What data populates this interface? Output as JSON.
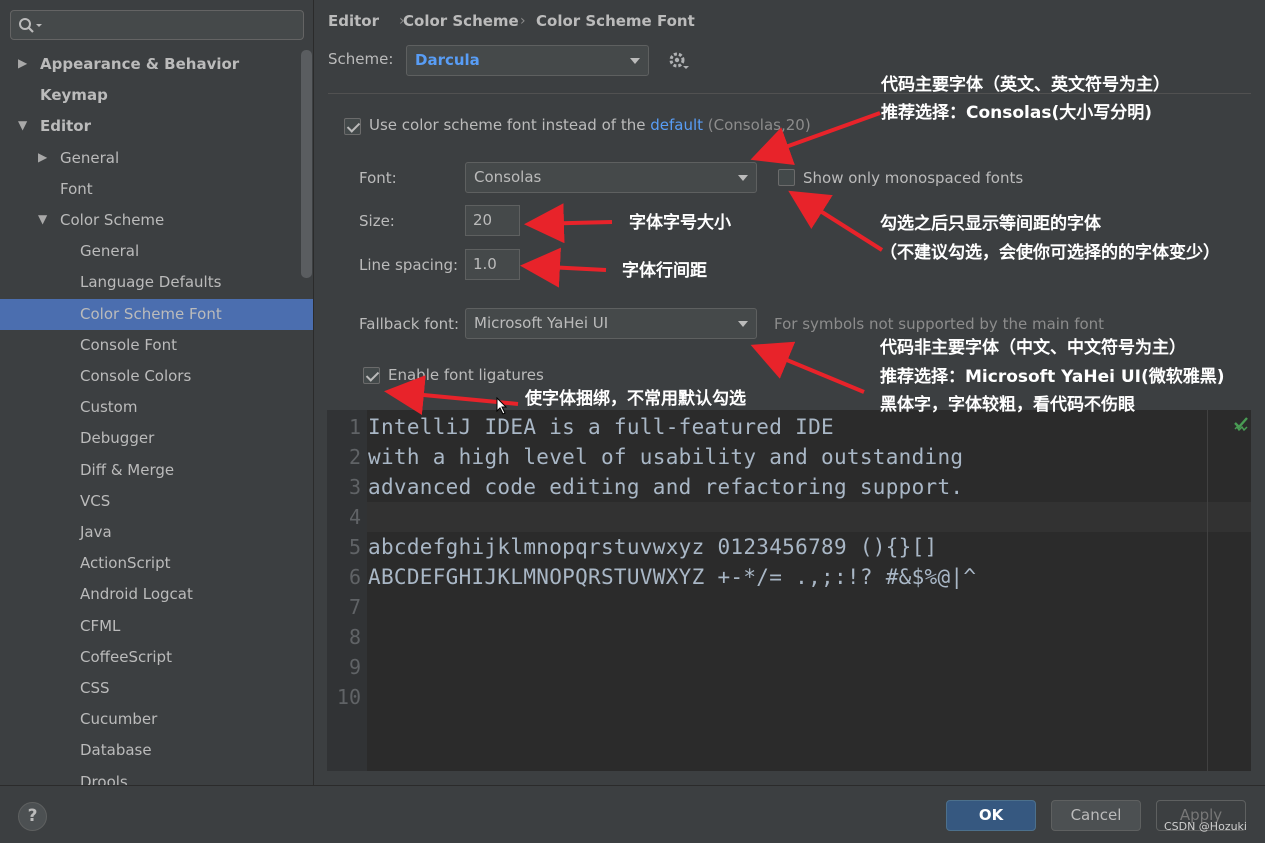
{
  "sidebar": {
    "search_placeholder": "",
    "items": [
      {
        "label": "Appearance & Behavior",
        "level": 0,
        "expanded": false,
        "bold": true
      },
      {
        "label": "Keymap",
        "level": 0,
        "bold": true
      },
      {
        "label": "Editor",
        "level": 0,
        "expanded": true,
        "bold": true
      },
      {
        "label": "General",
        "level": 1,
        "expanded": false
      },
      {
        "label": "Font",
        "level": 1
      },
      {
        "label": "Color Scheme",
        "level": 1,
        "expanded": true
      },
      {
        "label": "General",
        "level": 2
      },
      {
        "label": "Language Defaults",
        "level": 2
      },
      {
        "label": "Color Scheme Font",
        "level": 2,
        "selected": true
      },
      {
        "label": "Console Font",
        "level": 2
      },
      {
        "label": "Console Colors",
        "level": 2
      },
      {
        "label": "Custom",
        "level": 2
      },
      {
        "label": "Debugger",
        "level": 2
      },
      {
        "label": "Diff & Merge",
        "level": 2
      },
      {
        "label": "VCS",
        "level": 2
      },
      {
        "label": "Java",
        "level": 2
      },
      {
        "label": "ActionScript",
        "level": 2
      },
      {
        "label": "Android Logcat",
        "level": 2
      },
      {
        "label": "CFML",
        "level": 2
      },
      {
        "label": "CoffeeScript",
        "level": 2
      },
      {
        "label": "CSS",
        "level": 2
      },
      {
        "label": "Cucumber",
        "level": 2
      },
      {
        "label": "Database",
        "level": 2
      },
      {
        "label": "Drools",
        "level": 2
      }
    ]
  },
  "breadcrumb": [
    "Editor",
    "Color Scheme",
    "Color Scheme Font"
  ],
  "scheme": {
    "label": "Scheme:",
    "value": "Darcula"
  },
  "use_scheme_font": {
    "prefix": "Use color scheme font instead of the",
    "link": "default",
    "suffix": "(Consolas,20)",
    "checked": true
  },
  "font": {
    "label": "Font:",
    "value": "Consolas"
  },
  "monospaced": {
    "label": "Show only monospaced fonts",
    "checked": false
  },
  "size": {
    "label": "Size:",
    "value": "20"
  },
  "line_spacing": {
    "label": "Line spacing:",
    "value": "1.0"
  },
  "fallback": {
    "label": "Fallback font:",
    "value": "Microsoft YaHei UI",
    "hint": "For symbols not supported by the main font"
  },
  "ligatures": {
    "label": "Enable font ligatures",
    "checked": true
  },
  "preview": {
    "line_numbers": [
      "1",
      "2",
      "3",
      "4",
      "5",
      "6",
      "7",
      "8",
      "9",
      "10"
    ],
    "lines": [
      "IntelliJ IDEA is a full-featured IDE",
      "with a high level of usability and outstanding",
      "advanced code editing and refactoring support.",
      "",
      "abcdefghijklmnopqrstuvwxyz 0123456789 (){}[]",
      "ABCDEFGHIJKLMNOPQRSTUVWXYZ +-*/= .,;:!? #&$%@|^",
      "",
      "",
      "",
      ""
    ]
  },
  "buttons": {
    "help": "?",
    "ok": "OK",
    "cancel": "Cancel",
    "apply": "Apply"
  },
  "watermark": "CSDN @Hozuki",
  "annotations": {
    "main_font_line1": "代码主要字体（英文、英文符号为主）",
    "main_font_line2": "推荐选择：Consolas(大小写分明)",
    "size": "字体字号大小",
    "line_spacing": "字体行间距",
    "mono_line1": "勾选之后只显示等间距的字体",
    "mono_line2": "（不建议勾选，会使你可选择的的字体变少）",
    "fallback_line1": "代码非主要字体（中文、中文符号为主）",
    "fallback_line2": "推荐选择：Microsoft YaHei UI(微软雅黑)",
    "fallback_line3": "黑体字，字体较粗，看代码不伤眼",
    "ligatures": "使字体捆绑，不常用默认勾选"
  },
  "colors": {
    "accent": "#4b6eaf",
    "link": "#589df6",
    "annotation_arrow": "#e8232a",
    "primary_button": "#365880"
  }
}
